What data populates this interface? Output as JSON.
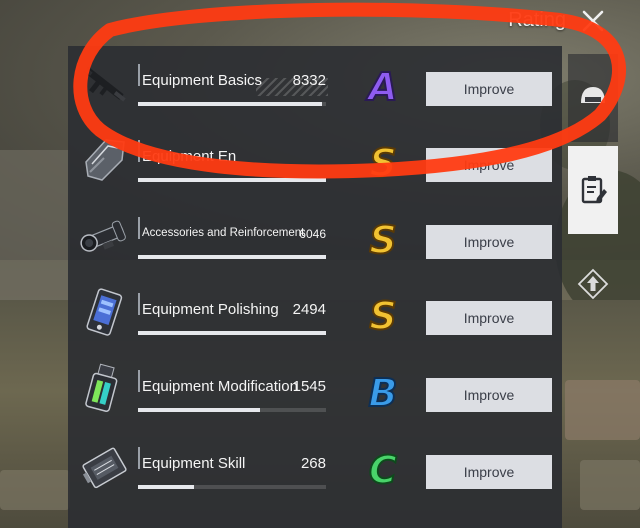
{
  "header": {
    "title": "Rating",
    "close_icon": "close-x-icon"
  },
  "items": [
    {
      "name": "Equipment Basics",
      "score": "8332",
      "grade": "A",
      "grade_color": "#8e5cf0",
      "progress": 0.98,
      "icon": "assault-rifle-icon",
      "button_label": "Improve",
      "small": false
    },
    {
      "name": "Equipment En",
      "score": "",
      "grade": "S",
      "grade_color": "#f1c232",
      "progress": 1.0,
      "icon": "armor-plate-icon",
      "button_label": "Improve",
      "small": false
    },
    {
      "name": "Accessories and Reinforcement",
      "score": "6046",
      "grade": "S",
      "grade_color": "#f1c232",
      "progress": 1.0,
      "icon": "scope-icon",
      "button_label": "Improve",
      "small": true
    },
    {
      "name": "Equipment Polishing",
      "score": "2494",
      "grade": "S",
      "grade_color": "#f1c232",
      "progress": 1.0,
      "icon": "polishing-device-icon",
      "button_label": "Improve",
      "small": false
    },
    {
      "name": "Equipment Modification",
      "score": "1545",
      "grade": "B",
      "grade_color": "#3a9be8",
      "progress": 0.65,
      "icon": "modification-cell-icon",
      "button_label": "Improve",
      "small": false
    },
    {
      "name": "Equipment Skill",
      "score": "268",
      "grade": "C",
      "grade_color": "#49d36a",
      "progress": 0.3,
      "icon": "skill-chip-icon",
      "button_label": "Improve",
      "small": false
    }
  ],
  "side_tabs": [
    {
      "icon": "helmet-icon",
      "active": false
    },
    {
      "icon": "clipboard-icon",
      "active": true
    },
    {
      "icon": "upgrade-arrow-icon",
      "active": false
    }
  ],
  "colors": {
    "panel_bg": "#2b2d32",
    "button_bg": "#dcdee3",
    "button_text": "#3a3e48",
    "annotation_red": "#ff3b12"
  }
}
